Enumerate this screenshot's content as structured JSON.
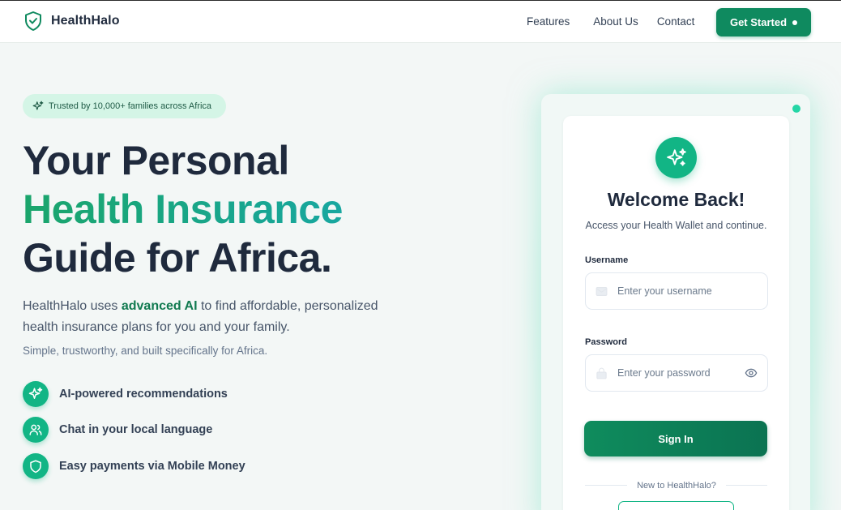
{
  "header": {
    "brand_name": "HealthHalo",
    "nav": [
      "Features",
      "About Us",
      "Contact"
    ],
    "cta_label": "Get Started"
  },
  "hero": {
    "badge": "Trusted by 10,000+ families across Africa",
    "title_line1": "Your Personal",
    "title_line2": "Health Insurance",
    "title_line3": "Guide for Africa.",
    "lead_prefix": "HealthHalo uses ",
    "lead_highlight": "advanced AI",
    "lead_suffix": " to find affordable, personalized health insurance plans for you and your family.",
    "sublead": "Simple, trustworthy, and built specifically for Africa.",
    "features": [
      {
        "label": "AI-powered recommendations",
        "icon": "sparkles-icon"
      },
      {
        "label": "Chat in your local language",
        "icon": "users-icon"
      },
      {
        "label": "Easy payments via Mobile Money",
        "icon": "shield-icon"
      }
    ]
  },
  "login": {
    "title": "Welcome Back!",
    "subtitle": "Access your Health Wallet and continue.",
    "username_label": "Username",
    "username_placeholder": "Enter your username",
    "password_label": "Password",
    "password_placeholder": "Enter your password",
    "signin_label": "Sign In",
    "new_prompt": "New to HealthHalo?"
  },
  "colors": {
    "brand_green": "#0f8a5f",
    "accent_teal": "#12b585",
    "badge_bg": "#d4f5e6",
    "heading": "#1f2a3d"
  }
}
